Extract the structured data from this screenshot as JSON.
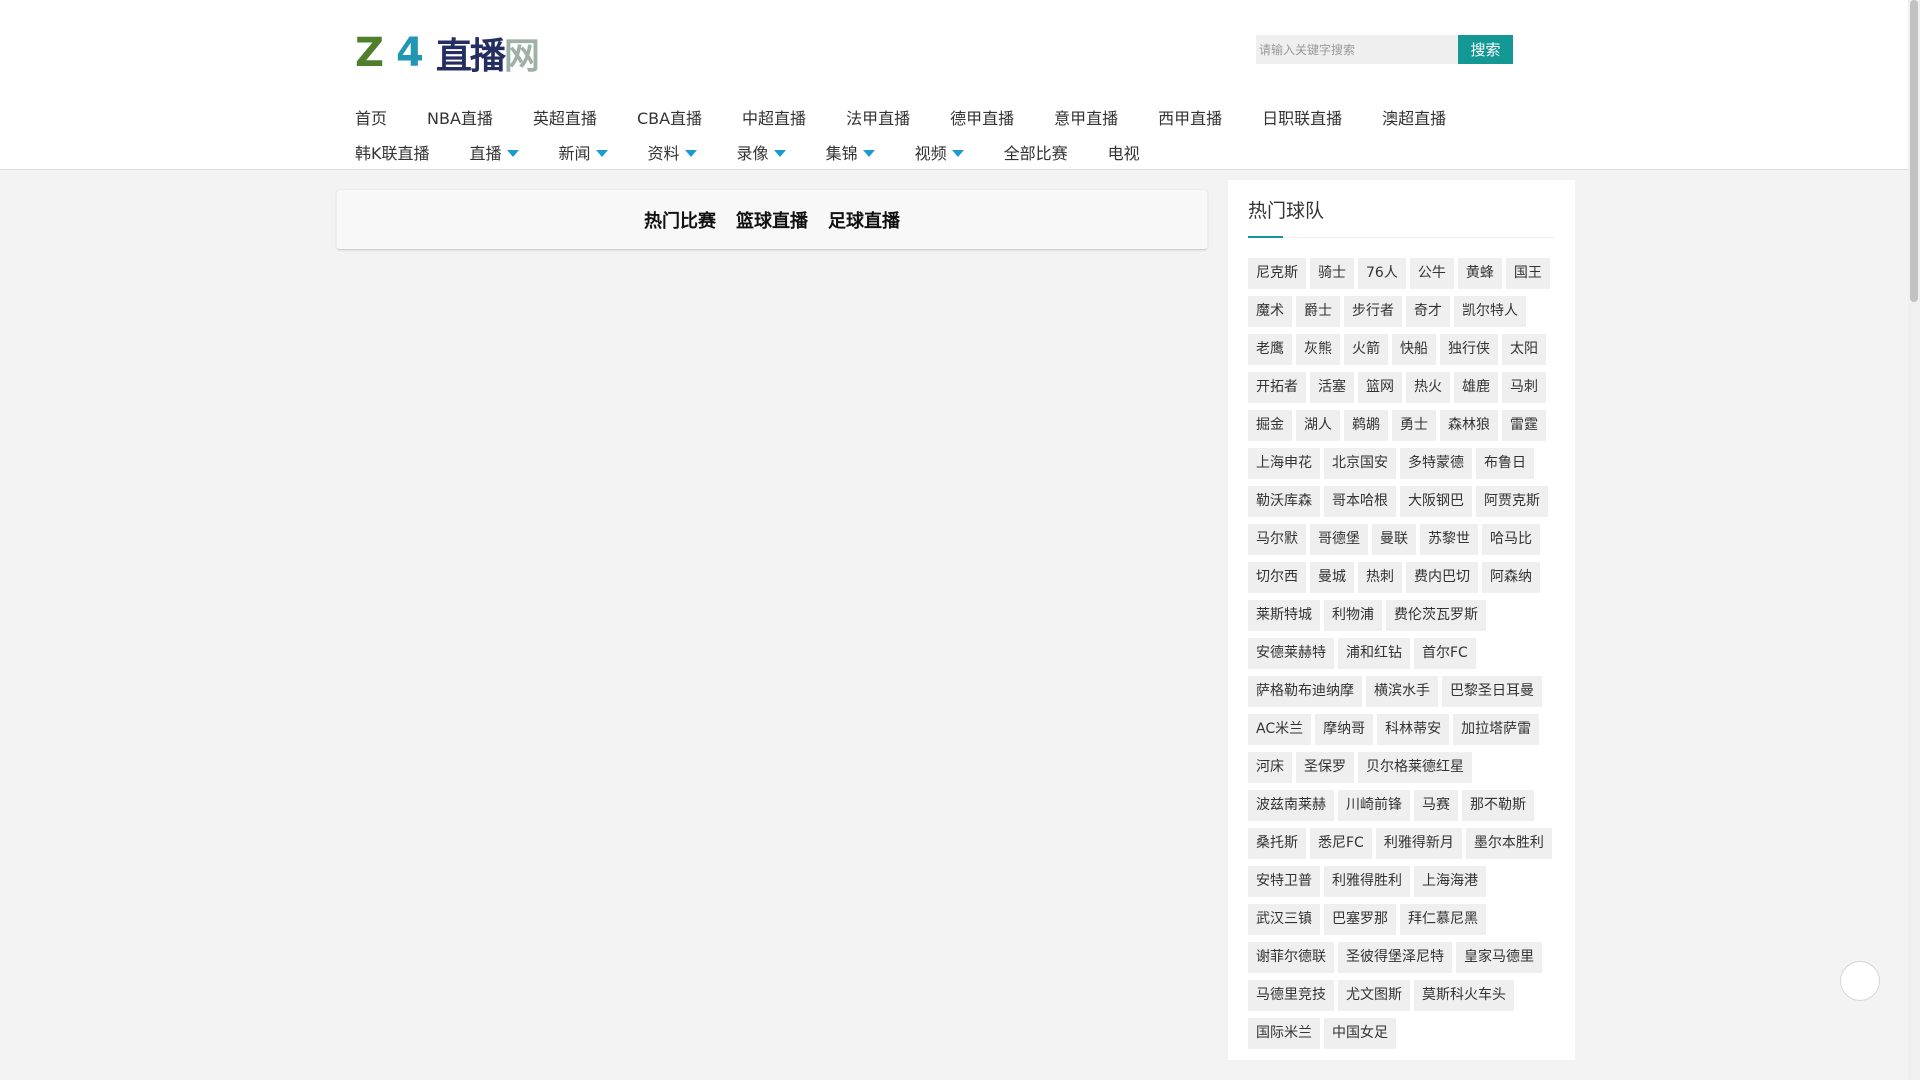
{
  "logo": {
    "part1": "Z",
    "part2": "4",
    "part3": "直播",
    "part4": "网"
  },
  "search": {
    "placeholder": "请输入关键字搜索",
    "button_label": "搜索"
  },
  "nav": {
    "row1": [
      "首页",
      "NBA直播",
      "英超直播",
      "CBA直播",
      "中超直播",
      "法甲直播",
      "德甲直播",
      "意甲直播",
      "西甲直播",
      "日职联直播",
      "澳超直播"
    ],
    "row2": [
      {
        "label": "韩K联直播",
        "dropdown": false
      },
      {
        "label": "直播",
        "dropdown": true
      },
      {
        "label": "新闻",
        "dropdown": true
      },
      {
        "label": "资料",
        "dropdown": true
      },
      {
        "label": "录像",
        "dropdown": true
      },
      {
        "label": "集锦",
        "dropdown": true
      },
      {
        "label": "视频",
        "dropdown": true
      },
      {
        "label": "全部比赛",
        "dropdown": false
      },
      {
        "label": "电视",
        "dropdown": false
      }
    ]
  },
  "main": {
    "tabs": [
      "热门比赛",
      "篮球直播",
      "足球直播"
    ]
  },
  "sidebar": {
    "title": "热门球队",
    "teams": [
      "尼克斯",
      "骑士",
      "76人",
      "公牛",
      "黄蜂",
      "国王",
      "魔术",
      "爵士",
      "步行者",
      "奇才",
      "凯尔特人",
      "老鹰",
      "灰熊",
      "火箭",
      "快船",
      "独行侠",
      "太阳",
      "开拓者",
      "活塞",
      "篮网",
      "热火",
      "雄鹿",
      "马刺",
      "掘金",
      "湖人",
      "鹈鹕",
      "勇士",
      "森林狼",
      "雷霆",
      "上海申花",
      "北京国安",
      "多特蒙德",
      "布鲁日",
      "勒沃库森",
      "哥本哈根",
      "大阪钢巴",
      "阿贾克斯",
      "马尔默",
      "哥德堡",
      "曼联",
      "苏黎世",
      "哈马比",
      "切尔西",
      "曼城",
      "热刺",
      "费内巴切",
      "阿森纳",
      "莱斯特城",
      "利物浦",
      "费伦茨瓦罗斯",
      "安德莱赫特",
      "浦和红钻",
      "首尔FC",
      "萨格勒布迪纳摩",
      "横滨水手",
      "巴黎圣日耳曼",
      "AC米兰",
      "摩纳哥",
      "科林蒂安",
      "加拉塔萨雷",
      "河床",
      "圣保罗",
      "贝尔格莱德红星",
      "波兹南莱赫",
      "川崎前锋",
      "马赛",
      "那不勒斯",
      "桑托斯",
      "悉尼FC",
      "利雅得新月",
      "墨尔本胜利",
      "安特卫普",
      "利雅得胜利",
      "上海海港",
      "武汉三镇",
      "巴塞罗那",
      "拜仁慕尼黑",
      "谢菲尔德联",
      "圣彼得堡泽尼特",
      "皇家马德里",
      "马德里竞技",
      "尤文图斯",
      "莫斯科火车头",
      "国际米兰",
      "中国女足"
    ]
  },
  "colors": {
    "accent": "#139896",
    "caret": "#1b9bd0",
    "logo_green": "#4f7f2b",
    "logo_blue": "#2196b3"
  }
}
